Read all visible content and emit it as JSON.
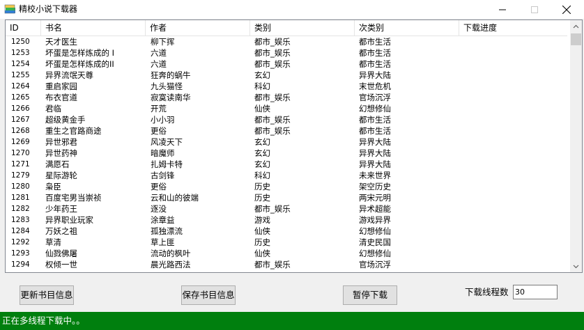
{
  "window": {
    "title": "精校小说下载器",
    "icon": "books-app-icon",
    "controls": [
      "minimize-icon",
      "maximize-icon",
      "close-icon"
    ]
  },
  "table": {
    "columns": [
      "ID",
      "书名",
      "作者",
      "类别",
      "次类别",
      "下载进度"
    ],
    "rows": [
      [
        "1250",
        "天才医生",
        "柳下挥",
        "都市_娱乐",
        "都市生活",
        ""
      ],
      [
        "1253",
        "坏蛋是怎样炼成的 I",
        "六道",
        "都市_娱乐",
        "都市生活",
        ""
      ],
      [
        "1254",
        "坏蛋是怎样炼成的II",
        "六道",
        "都市_娱乐",
        "都市生活",
        ""
      ],
      [
        "1255",
        "异界流氓天尊",
        "狂奔的蜗牛",
        "玄幻",
        "异界大陆",
        ""
      ],
      [
        "1264",
        "重启家园",
        "九头猫怪",
        "科幻",
        "末世危机",
        ""
      ],
      [
        "1265",
        "布衣官道",
        "寂寞读南华",
        "都市_娱乐",
        "官场沉浮",
        ""
      ],
      [
        "1266",
        "君临",
        "开荒",
        "仙侠",
        "幻想修仙",
        ""
      ],
      [
        "1267",
        "超级黄金手",
        "小小羽",
        "都市_娱乐",
        "都市生活",
        ""
      ],
      [
        "1268",
        "重生之官路商途",
        "更俗",
        "都市_娱乐",
        "都市生活",
        ""
      ],
      [
        "1269",
        "异世邪君",
        "风凌天下",
        "玄幻",
        "异界大陆",
        ""
      ],
      [
        "1270",
        "异世药神",
        "暗魔师",
        "玄幻",
        "异界大陆",
        ""
      ],
      [
        "1271",
        "满愿石",
        "扎姆卡特",
        "玄幻",
        "异界大陆",
        ""
      ],
      [
        "1279",
        "星际游轮",
        "古剑锋",
        "科幻",
        "未来世界",
        ""
      ],
      [
        "1280",
        "枭臣",
        "更俗",
        "历史",
        "架空历史",
        ""
      ],
      [
        "1281",
        "百度宅男当崇祯",
        "云和山的彼端",
        "历史",
        "两宋元明",
        ""
      ],
      [
        "1282",
        "少年药王",
        "逐没",
        "都市_娱乐",
        "异术超能",
        ""
      ],
      [
        "1283",
        "异界职业玩家",
        "涂章益",
        "游戏",
        "游戏异界",
        ""
      ],
      [
        "1284",
        "万妖之祖",
        "孤独漂流",
        "仙侠",
        "幻想修仙",
        ""
      ],
      [
        "1292",
        "草清",
        "草上匪",
        "历史",
        "清史民国",
        ""
      ],
      [
        "1293",
        "仙戮佛屠",
        "流动的枫叶",
        "仙侠",
        "幻想修仙",
        ""
      ],
      [
        "1294",
        "权倾一世",
        "晨光路西法",
        "都市_娱乐",
        "官场沉浮",
        ""
      ]
    ]
  },
  "buttons": {
    "update": "更新书目信息",
    "save": "保存书目信息",
    "pause": "暂停下载"
  },
  "threads": {
    "label": "下载线程数",
    "value": "30"
  },
  "status": {
    "text": "正在多线程下载中。。",
    "color": "#007f0e"
  }
}
